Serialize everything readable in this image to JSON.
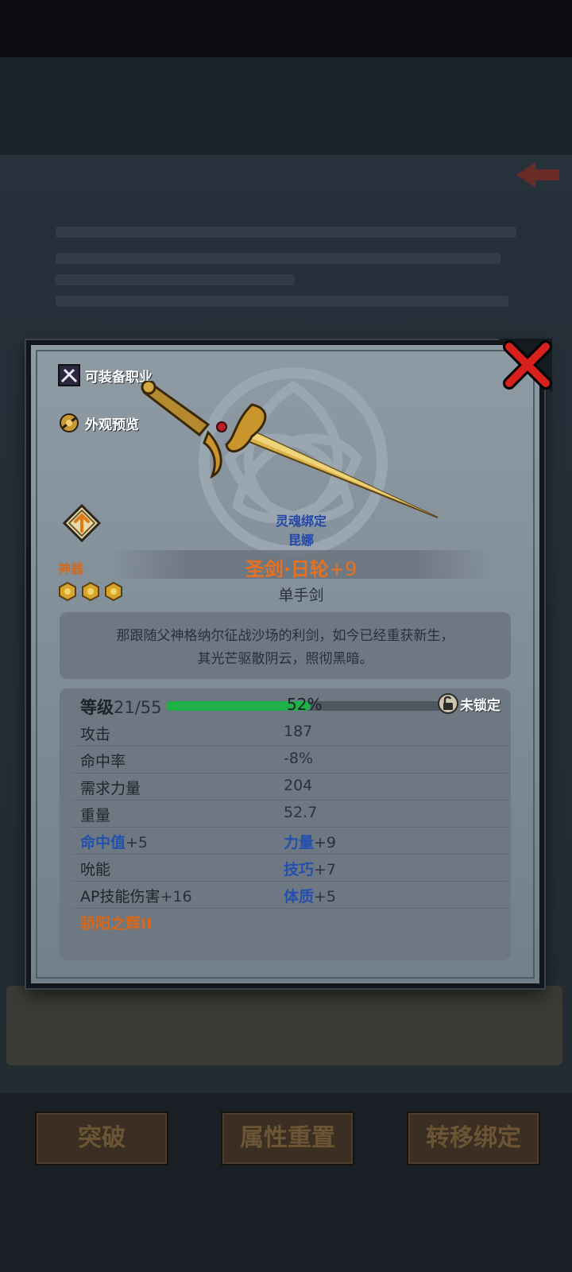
{
  "background": {
    "bottom_buttons": [
      "突破",
      "属性重置",
      "转移绑定"
    ]
  },
  "item": {
    "equip_class_label": "可装备职业",
    "appearance_label": "外观预览",
    "soulbound_label": "灵魂绑定",
    "bound_to": "昆娜",
    "rarity": "神器",
    "star_count": 3,
    "name": "圣剑·日轮",
    "plus": "+9",
    "type": "单手剑",
    "description": [
      "那跟随父神格纳尔征战沙场的利剑，如今已经重获新生，",
      "其光芒驱散阴云，照彻黑暗。"
    ],
    "level_label": "等级",
    "level_value": "21/55",
    "xp_percent": 52,
    "xp_text": "52%",
    "lock_text": "未锁定",
    "stats": [
      {
        "label": "攻击",
        "value": "187"
      },
      {
        "label": "命中率",
        "value": "-8%"
      },
      {
        "label": "需求力量",
        "value": "204"
      },
      {
        "label": "重量",
        "value": "52.7"
      }
    ],
    "bonuses": [
      {
        "left_name": "命中值",
        "left_val": "+5",
        "right_name": "力量",
        "right_val": "+9"
      },
      {
        "left_name": "吮能",
        "left_val": "",
        "right_name": "技巧",
        "right_val": "+7"
      },
      {
        "left_name": "AP技能伤害",
        "left_val": "+16",
        "right_name": "体质",
        "right_val": "+5"
      }
    ],
    "skill": "骄阳之辉II"
  },
  "colors": {
    "rarity": "#d2691e",
    "name": "#e8701e",
    "bonus": "#2350ae",
    "xp_fill": "#1fb048",
    "close_x": "#d8201e"
  }
}
